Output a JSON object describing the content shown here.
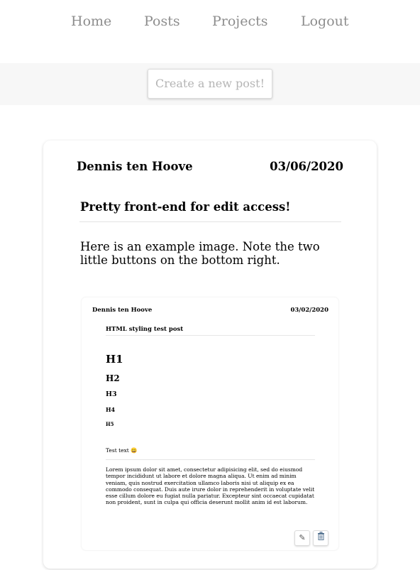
{
  "nav": {
    "items": [
      {
        "label": "Home"
      },
      {
        "label": "Posts"
      },
      {
        "label": "Projects"
      },
      {
        "label": "Logout"
      }
    ]
  },
  "actions": {
    "create_post_label": "Create a new post!"
  },
  "post": {
    "author": "Dennis ten Hoove",
    "date": "03/06/2020",
    "title": "Pretty front-end for edit access!",
    "body": "Here is an example image. Note the two little buttons on the bottom right."
  },
  "example_image": {
    "author": "Dennis ten Hoove",
    "date": "03/02/2020",
    "title": "HTML styling test post",
    "headings": [
      "H1",
      "H2",
      "H3",
      "H4",
      "H5"
    ],
    "test_text": "Test text 😀",
    "lorem": "Lorem ipsum dolor sit amet, consectetur adipisicing elit, sed do eiusmod tempor incididunt ut labore et dolore magna aliqua. Ut enim ad minim veniam, quis nostrud exercitation ullamco laboris nisi ut aliquip ex ea commodo consequat. Duis aute irure dolor in reprehenderit in voluptate velit esse cillum dolore eu fugiat nulla pariatur. Excepteur sint occaecat cupidatat non proident, sunt in culpa qui officia deserunt mollit anim id est laborum.",
    "edit_icon": "pencil-icon",
    "delete_icon": "trash-icon"
  }
}
